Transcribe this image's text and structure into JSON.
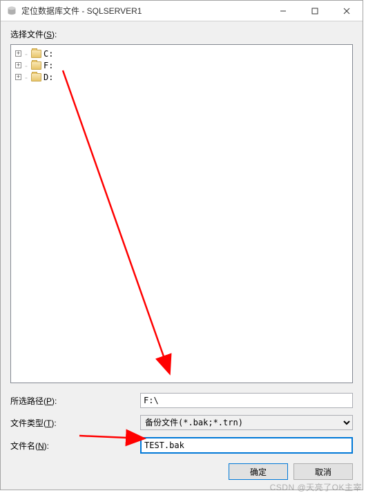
{
  "titlebar": {
    "title": "定位数据库文件 - SQLSERVER1"
  },
  "select_files_label": "选择文件(S):",
  "tree": {
    "drives": [
      {
        "label": "C:"
      },
      {
        "label": "F:"
      },
      {
        "label": "D:"
      }
    ]
  },
  "path": {
    "label_pre": "所选路径(",
    "access": "P",
    "label_post": "):",
    "value": "F:\\"
  },
  "file_type": {
    "label_pre": "文件类型(",
    "access": "T",
    "label_post": "):",
    "value": "备份文件(*.bak;*.trn)"
  },
  "filename": {
    "label_pre": "文件名(",
    "access": "N",
    "label_post": ":",
    "value": "TEST.bak"
  },
  "buttons": {
    "ok": "确定",
    "cancel": "取消"
  },
  "watermark": "CSDN @天亮了OK主宰"
}
